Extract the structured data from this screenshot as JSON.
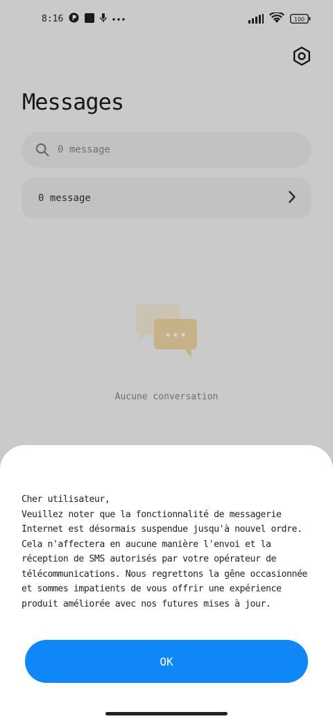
{
  "status_bar": {
    "time": "8:16",
    "battery": "100",
    "icons": [
      "app-notification-icon",
      "square-notification-icon",
      "microphone-icon",
      "more-dots-icon",
      "signal-icon",
      "wifi-icon",
      "battery-icon"
    ]
  },
  "header": {
    "title": "Messages",
    "settings_icon": "settings-gear-icon"
  },
  "search": {
    "text": "0 message",
    "icon": "search-icon"
  },
  "list_row": {
    "label": "0 message",
    "icon": "chevron-right-icon"
  },
  "empty_state": {
    "icon": "chat-bubbles-icon",
    "text": "Aucune conversation"
  },
  "dialog": {
    "message": "Cher utilisateur,\nVeuillez noter que la fonctionnalité de messagerie Internet est désormais suspendue jusqu'à nouvel ordre. Cela n'affectera en aucune manière l'envoi et la réception de SMS autorisés par votre opérateur de télécommunications. Nous regrettons la gêne occasionnée et sommes impatients de vous offrir une expérience produit améliorée avec nos futures mises à jour.",
    "ok_label": "OK"
  },
  "colors": {
    "accent": "#0f87f7",
    "illustration": "#f3d9a6"
  }
}
